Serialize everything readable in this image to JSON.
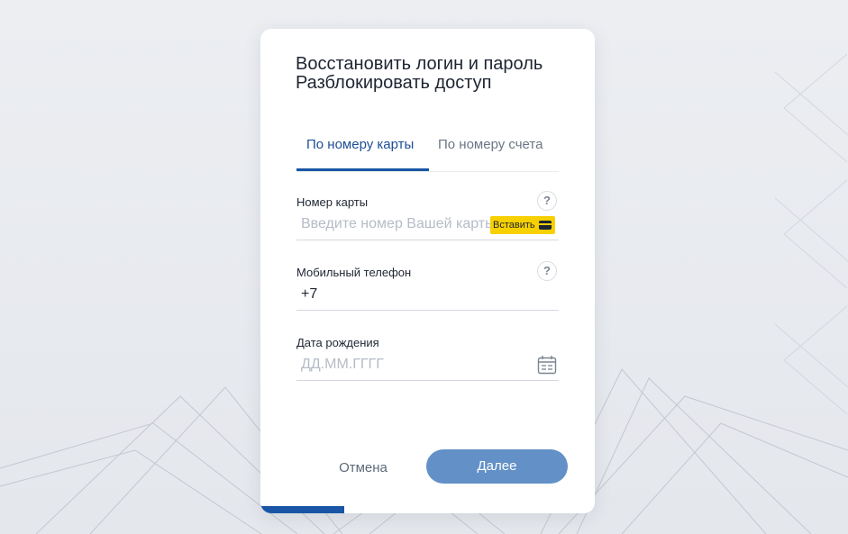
{
  "dialog": {
    "title_line1": "Восстановить логин и пароль",
    "title_line2": "Разблокировать доступ"
  },
  "tabs": [
    {
      "label": "По номеру карты",
      "active": true
    },
    {
      "label": "По номеру счета",
      "active": false
    }
  ],
  "fields": {
    "card_number": {
      "label": "Номер карты",
      "value": "",
      "placeholder": "Введите номер Вашей карты",
      "paste_label": "Вставить"
    },
    "mobile_phone": {
      "label": "Мобильный телефон",
      "value": "+7",
      "placeholder": ""
    },
    "birth_date": {
      "label": "Дата рождения",
      "value": "",
      "placeholder": "ДД.ММ.ГГГГ"
    }
  },
  "help_glyph": "?",
  "actions": {
    "cancel_label": "Отмена",
    "next_label": "Далее"
  },
  "progress": {
    "fraction": 0.25
  },
  "colors": {
    "accent": "#1a56a5",
    "button": "#6391c7",
    "paste": "#f7d000",
    "background": "#eceef2"
  },
  "icons": {
    "help": "question-circle-icon",
    "paste": "card-icon",
    "calendar": "calendar-icon"
  }
}
